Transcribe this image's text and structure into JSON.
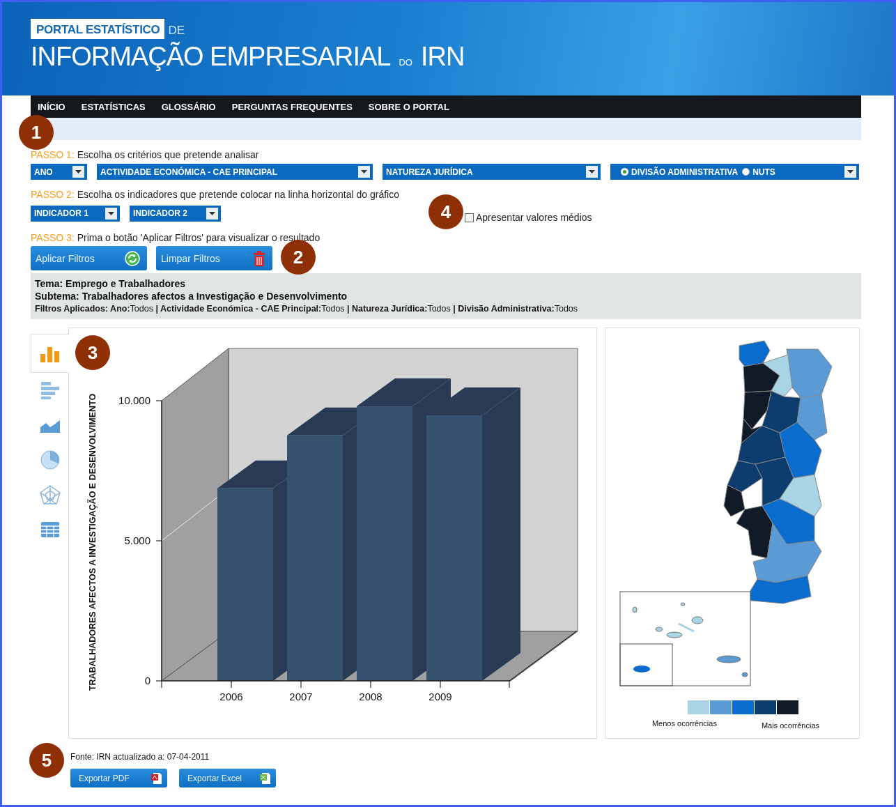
{
  "header": {
    "logo_label": "PORTAL ESTATÍSTICO",
    "logo_suffix": "DE",
    "title": "INFORMAÇÃO EMPRESARIAL",
    "title_connector": "DO",
    "title_end": "IRN"
  },
  "nav": [
    {
      "label": "INÍCIO"
    },
    {
      "label": "ESTATÍSTICAS"
    },
    {
      "label": "GLOSSÁRIO"
    },
    {
      "label": "PERGUNTAS FREQUENTES"
    },
    {
      "label": "SOBRE O PORTAL"
    }
  ],
  "step_1": {
    "label": "PASSO 1:",
    "instruction": "Escolha os critérios que pretende analisar",
    "dropdowns": [
      {
        "kind": "plain",
        "label": "ANO"
      },
      {
        "kind": "plain",
        "label": "ACTIVIDADE ECONÓMICA - CAE PRINCIPAL"
      },
      {
        "kind": "plain",
        "label": "NATUREZA JURÍDICA"
      },
      {
        "kind": "radio",
        "options": [
          {
            "label": "DIVISÃO ADMINISTRATIVA",
            "selected": true
          },
          {
            "label": "NUTS",
            "selected": false
          }
        ]
      }
    ]
  },
  "step_2": {
    "label": "PASSO 2:",
    "instruction": "Escolha os indicadores que pretende colocar na linha horizontal do gráfico",
    "dropdowns": [
      {
        "kind": "plain",
        "label": "INDICADOR 1"
      },
      {
        "kind": "plain",
        "label": "INDICADOR 2"
      }
    ],
    "checkbox": {
      "label": "Apresentar valores médios",
      "checked": false
    }
  },
  "step_3": {
    "label": "PASSO 3:",
    "instruction": "Prima o botão 'Aplicar Filtros' para visualizar o resultado",
    "buttons": [
      {
        "kind": "apply",
        "label": "Aplicar Filtros"
      },
      {
        "kind": "clear",
        "label": "Limpar Filtros"
      }
    ]
  },
  "summary": [
    {
      "kind": "heading",
      "text": "Tema: Emprego e Trabalhadores"
    },
    {
      "kind": "heading",
      "text": "Subtema: Trabalhadores afectos a Investigação e Desenvolvimento"
    },
    {
      "kind": "filters",
      "text": "**Filtros Aplicados: Ano:**Todos **| Actividade Económica - CAE Principal:**Todos **| Natureza Jurídica:**Todos **| Divisão Administrativa:**Todos"
    }
  ],
  "chart_types": [
    {
      "kind": "bar",
      "selected": true
    },
    {
      "kind": "horizontal-bar",
      "selected": false
    },
    {
      "kind": "area",
      "selected": false
    },
    {
      "kind": "pie",
      "selected": false
    },
    {
      "kind": "radar",
      "selected": false
    },
    {
      "kind": "table",
      "selected": false
    }
  ],
  "chart": {
    "chart_data": {
      "type": "bar",
      "ylabel": "TRABALHADORES AFECTOS A INVESTIGAÇÃO E DESENVOLVIMENTO",
      "categories": [
        "2006",
        "2007",
        "2008",
        "2009"
      ],
      "series": [
        {
          "color": "#36526f",
          "values": [
            6870,
            8760,
            9800,
            9480
          ]
        }
      ],
      "ylim": [
        0,
        10000
      ],
      "yticks": [
        {
          "value": 0,
          "label": "0"
        },
        {
          "value": 5000,
          "label": "5.000"
        },
        {
          "value": 10000,
          "label": "10.000"
        }
      ]
    }
  },
  "map": {
    "legend": {
      "colors": [
        {
          "color": "#a8d4e6"
        },
        {
          "color": "#5b9bd5"
        },
        {
          "color": "#0a6ccc"
        },
        {
          "color": "#0d3d6e"
        },
        {
          "color": "#111a27"
        }
      ],
      "low_label": "Menos ocorrências",
      "high_label": "Mais ocorrências"
    }
  },
  "footer": {
    "source": "Fonte: IRN actualizado a: 07-04-2011",
    "buttons": [
      {
        "kind": "pdf",
        "label": "Exportar PDF"
      },
      {
        "kind": "excel",
        "label": "Exportar Excel"
      }
    ]
  },
  "annotations": [
    {
      "number": "1"
    },
    {
      "number": "2"
    },
    {
      "number": "3"
    },
    {
      "number": "4"
    },
    {
      "number": "5"
    }
  ]
}
